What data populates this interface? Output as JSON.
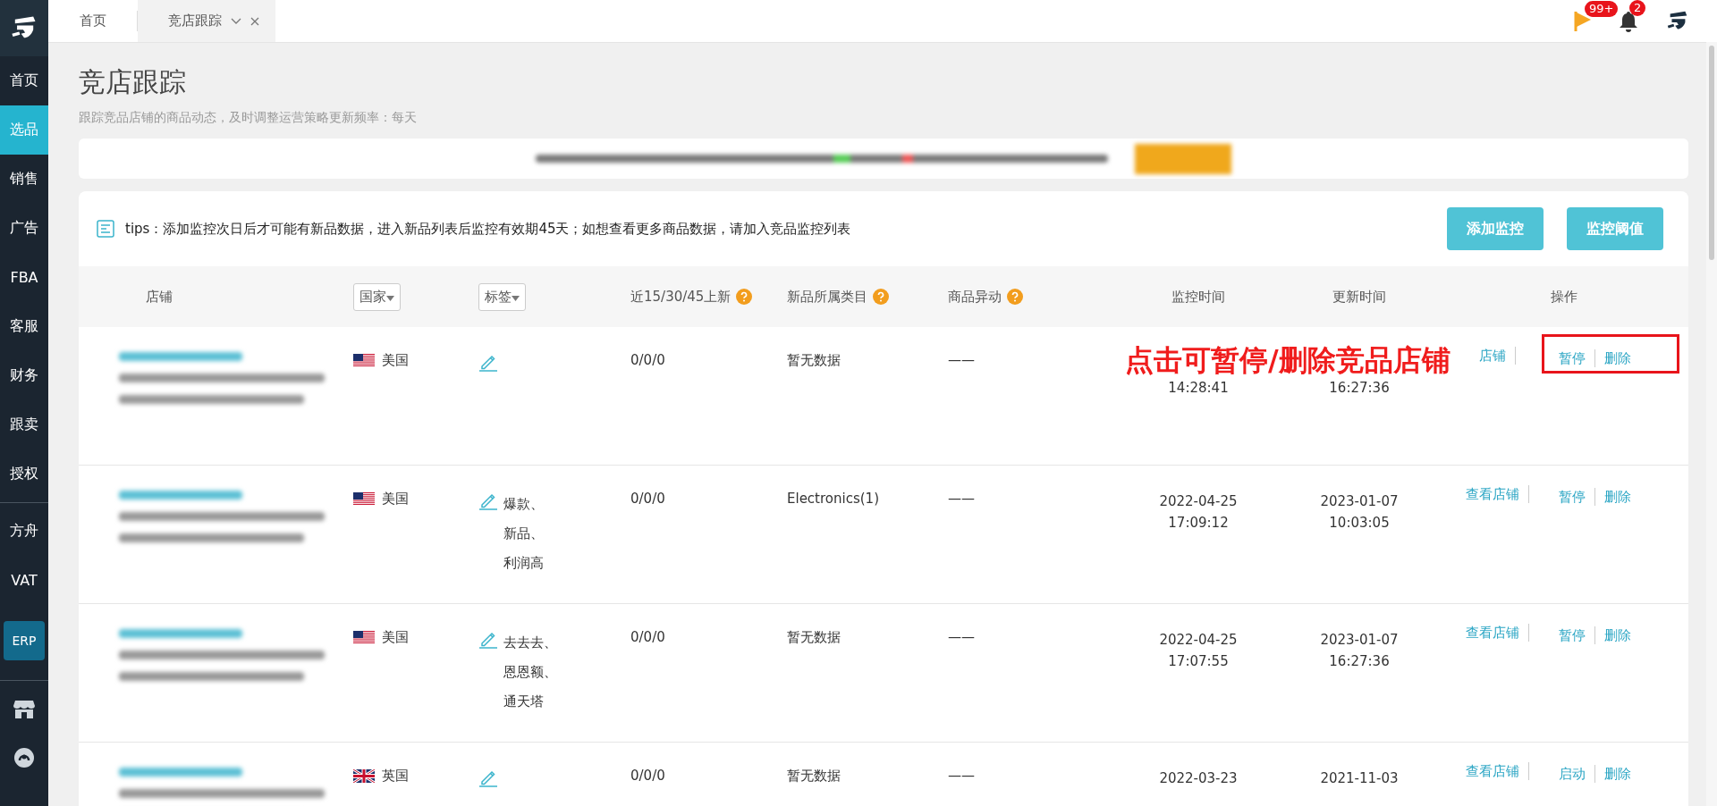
{
  "sidebar": {
    "items": [
      {
        "label": "首页",
        "selected": false
      },
      {
        "label": "选品",
        "selected": true
      },
      {
        "label": "销售",
        "selected": false
      },
      {
        "label": "广告",
        "selected": false
      },
      {
        "label": "FBA",
        "selected": false
      },
      {
        "label": "客服",
        "selected": false
      },
      {
        "label": "财务",
        "selected": false
      },
      {
        "label": "跟卖",
        "selected": false
      },
      {
        "label": "授权",
        "selected": false
      }
    ],
    "more_items": [
      {
        "label": "方舟",
        "selected": false
      },
      {
        "label": "VAT",
        "selected": false
      }
    ],
    "erp_button": "ERP"
  },
  "tabs": [
    {
      "label": "首页",
      "selected": false,
      "closable": false
    },
    {
      "label": "竞店跟踪",
      "selected": true,
      "closable": true
    }
  ],
  "header": {
    "flag_badge": "99+",
    "bell_badge": "2"
  },
  "page": {
    "title": "竞店跟踪",
    "subtitle": "跟踪竞品店铺的商品动态，及时调整运营策略更新频率：每天"
  },
  "tips": "tips：添加监控次日后才可能有新品数据，进入新品列表后监控有效期45天；如想查看更多商品数据，请加入竞品监控列表",
  "buttons": [
    "添加监控",
    "监控阈值"
  ],
  "table": {
    "columns": [
      {
        "label": "店铺",
        "kind": "text"
      },
      {
        "label": "国家",
        "kind": "select"
      },
      {
        "label": "标签",
        "kind": "select"
      },
      {
        "label": "近15/30/45上新",
        "kind": "help"
      },
      {
        "label": "新品所属类目",
        "kind": "help"
      },
      {
        "label": "商品异动",
        "kind": "help"
      },
      {
        "label": "监控时间",
        "kind": "text"
      },
      {
        "label": "更新时间",
        "kind": "text"
      },
      {
        "label": "操作",
        "kind": "text"
      }
    ],
    "rows": [
      {
        "kind": "us",
        "country": "美国",
        "tags": [],
        "new_counts": "0/0/0",
        "category": "暂无数据",
        "change": "——",
        "monitor_time": [
          "14:28:41"
        ],
        "update_time": [
          "16:27:36"
        ],
        "highlighted": true,
        "actions": [
          {
            "kind": "view",
            "label": "店铺"
          },
          {
            "kind": "toggle",
            "label": "暂停"
          },
          {
            "kind": "delete",
            "label": "删除"
          }
        ]
      },
      {
        "kind": "us",
        "country": "美国",
        "tags": [
          "爆款、",
          "新品、",
          "利润高"
        ],
        "new_counts": "0/0/0",
        "category": "Electronics(1)",
        "change": "——",
        "monitor_time": [
          "2022-04-25",
          "17:09:12"
        ],
        "update_time": [
          "2023-01-07",
          "10:03:05"
        ],
        "highlighted": false,
        "actions": [
          {
            "kind": "view",
            "label": "查看店铺"
          },
          {
            "kind": "toggle",
            "label": "暂停"
          },
          {
            "kind": "delete",
            "label": "删除"
          }
        ]
      },
      {
        "kind": "us",
        "country": "美国",
        "tags": [
          "去去去、",
          "恩恩额、",
          "通天塔"
        ],
        "new_counts": "0/0/0",
        "category": "暂无数据",
        "change": "——",
        "monitor_time": [
          "2022-04-25",
          "17:07:55"
        ],
        "update_time": [
          "2023-01-07",
          "16:27:36"
        ],
        "highlighted": false,
        "actions": [
          {
            "kind": "view",
            "label": "查看店铺"
          },
          {
            "kind": "toggle",
            "label": "暂停"
          },
          {
            "kind": "delete",
            "label": "删除"
          }
        ]
      },
      {
        "kind": "uk",
        "country": "英国",
        "tags": [],
        "new_counts": "0/0/0",
        "category": "暂无数据",
        "change": "——",
        "monitor_time": [
          "2022-03-23"
        ],
        "update_time": [
          "2021-11-03"
        ],
        "highlighted": false,
        "actions": [
          {
            "kind": "view",
            "label": "查看店铺"
          },
          {
            "kind": "toggle",
            "label": "启动"
          },
          {
            "kind": "delete",
            "label": "删除"
          }
        ]
      }
    ]
  },
  "annotation": "点击可暂停/删除竞品店铺"
}
